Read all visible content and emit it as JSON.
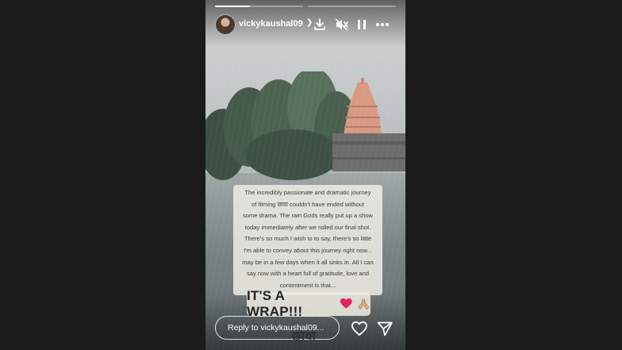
{
  "story": {
    "username": "vickykaushal09",
    "progress_segments": [
      0.4,
      0.0
    ],
    "caption_lines": [
      "The incredibly passionate and dramatic journey",
      "of filming छावा couldn't have ended without",
      "some drama. The rain Gods really put up a show",
      "today immediately after we rolled our final shot.",
      "There's so much I wish to to say, there's so little",
      "I'm able to convey about this journey right now...",
      "may be in a few days when it all sinks in. All I can",
      "say now with a heart full of gratitude, love and",
      "contentment is that..."
    ],
    "wrap_text": "IT'S A WRAP!!!",
    "wrap_emoji_icons": [
      "red-heart-icon",
      "folded-hands-icon"
    ],
    "watermark": "छावा"
  },
  "reply": {
    "placeholder": "Reply to vickykaushal09..."
  },
  "icons": {
    "header": [
      "download-icon",
      "mute-icon",
      "pause-icon",
      "more-options-icon"
    ],
    "footer": [
      "like-heart-icon",
      "share-icon"
    ]
  },
  "colors": {
    "page_background": "#1b1b1b",
    "overlay_text": "#ffffff",
    "caption_background": "#eceae2",
    "heart": "#e0245e",
    "temple": "#d89a82"
  }
}
